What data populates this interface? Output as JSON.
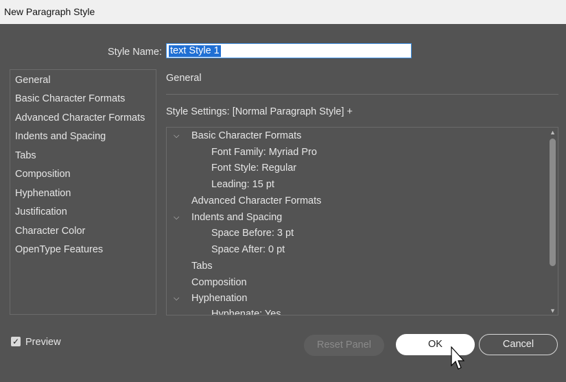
{
  "window": {
    "title": "New Paragraph Style"
  },
  "style_name": {
    "label": "Style Name:",
    "value": "text Style 1"
  },
  "categories": [
    "General",
    "Basic Character Formats",
    "Advanced Character Formats",
    "Indents and Spacing",
    "Tabs",
    "Composition",
    "Hyphenation",
    "Justification",
    "Character Color",
    "OpenType Features"
  ],
  "panel": {
    "title": "General",
    "settings_label": "Style Settings: [Normal Paragraph Style] +"
  },
  "tree": [
    {
      "text": "Basic Character Formats",
      "level": 0,
      "expanded": true
    },
    {
      "text": "Font Family: Myriad Pro",
      "level": 1
    },
    {
      "text": "Font Style: Regular",
      "level": 1
    },
    {
      "text": "Leading: 15 pt",
      "level": 1
    },
    {
      "text": "Advanced Character Formats",
      "level": 0
    },
    {
      "text": "Indents and Spacing",
      "level": 0,
      "expanded": true
    },
    {
      "text": "Space Before: 3 pt",
      "level": 1
    },
    {
      "text": "Space After: 0 pt",
      "level": 1
    },
    {
      "text": "Tabs",
      "level": 0
    },
    {
      "text": "Composition",
      "level": 0
    },
    {
      "text": "Hyphenation",
      "level": 0,
      "expanded": true
    },
    {
      "text": "Hyphenate: Yes",
      "level": 1
    }
  ],
  "preview": {
    "label": "Preview",
    "checked": true
  },
  "buttons": {
    "reset": "Reset Panel",
    "ok": "OK",
    "cancel": "Cancel"
  }
}
